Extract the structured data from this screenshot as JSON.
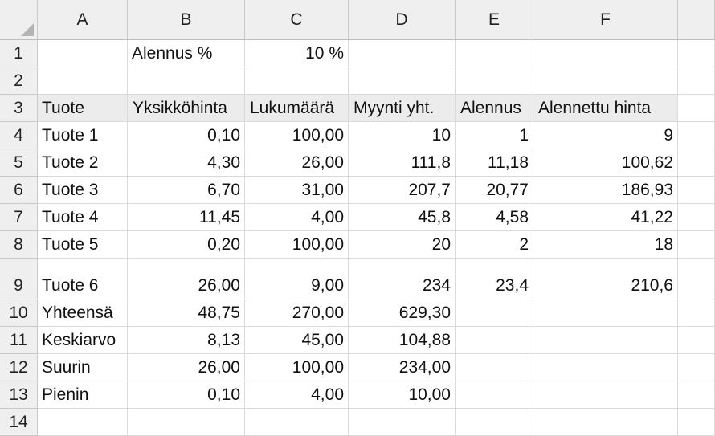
{
  "columns": [
    "A",
    "B",
    "C",
    "D",
    "E",
    "F"
  ],
  "rows": [
    {
      "num": "1",
      "A": "",
      "B": "Alennus %",
      "C": "10 %",
      "D": "",
      "E": "",
      "F": ""
    },
    {
      "num": "2",
      "A": "",
      "B": "",
      "C": "",
      "D": "",
      "E": "",
      "F": ""
    },
    {
      "num": "3",
      "A": "Tuote",
      "B": "Yksikköhinta",
      "C": "Lukumäärä",
      "D": "Myynti yht.",
      "E": "Alennus",
      "F": "Alennettu hinta"
    },
    {
      "num": "4",
      "A": "Tuote 1",
      "B": "0,10",
      "C": "100,00",
      "D": "10",
      "E": "1",
      "F": "9"
    },
    {
      "num": "5",
      "A": "Tuote 2",
      "B": "4,30",
      "C": "26,00",
      "D": "111,8",
      "E": "11,18",
      "F": "100,62"
    },
    {
      "num": "6",
      "A": "Tuote 3",
      "B": "6,70",
      "C": "31,00",
      "D": "207,7",
      "E": "20,77",
      "F": "186,93"
    },
    {
      "num": "7",
      "A": "Tuote 4",
      "B": "11,45",
      "C": "4,00",
      "D": "45,8",
      "E": "4,58",
      "F": "41,22"
    },
    {
      "num": "8",
      "A": "Tuote 5",
      "B": "0,20",
      "C": "100,00",
      "D": "20",
      "E": "2",
      "F": "18"
    },
    {
      "num": "9",
      "A": "Tuote 6",
      "B": "26,00",
      "C": "9,00",
      "D": "234",
      "E": "23,4",
      "F": "210,6"
    },
    {
      "num": "10",
      "A": "Yhteensä",
      "B": "48,75",
      "C": "270,00",
      "D": "629,30",
      "E": "",
      "F": ""
    },
    {
      "num": "11",
      "A": "Keskiarvo",
      "B": "8,13",
      "C": "45,00",
      "D": "104,88",
      "E": "",
      "F": ""
    },
    {
      "num": "12",
      "A": "Suurin",
      "B": "26,00",
      "C": "100,00",
      "D": "234,00",
      "E": "",
      "F": ""
    },
    {
      "num": "13",
      "A": "Pienin",
      "B": "0,10",
      "C": "4,00",
      "D": "10,00",
      "E": "",
      "F": ""
    },
    {
      "num": "14",
      "A": "",
      "B": "",
      "C": "",
      "D": "",
      "E": "",
      "F": ""
    }
  ],
  "colors": {
    "header_band": "#ececec",
    "gridline": "#dadada",
    "header_bg": "#efefef"
  }
}
